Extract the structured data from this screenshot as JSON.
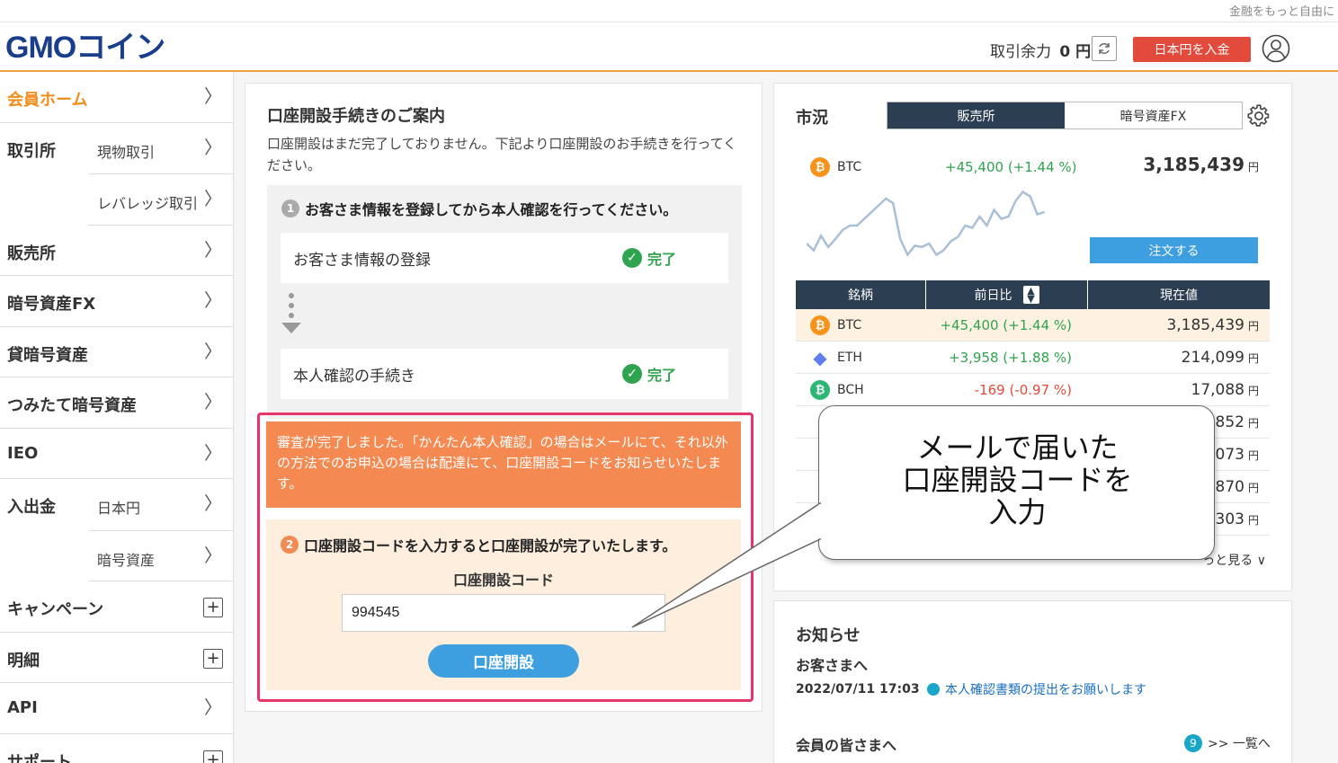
{
  "tagline": "金融をもっと自由に",
  "header": {
    "logo": "GMOコイン",
    "balance_label": "取引余力",
    "balance_value": "0 円",
    "deposit_button": "日本円を入金"
  },
  "sidebar": {
    "home": "会員ホーム",
    "exchange": "取引所",
    "spot": "現物取引",
    "leverage": "レバレッジ取引",
    "sales": "販売所",
    "crypto_fx": "暗号資産FX",
    "lending": "貸暗号資産",
    "tsumitate": "つみたて暗号資産",
    "ieo": "IEO",
    "deposit": "入出金",
    "jpy": "日本円",
    "crypto": "暗号資産",
    "campaign": "キャンペーン",
    "statement": "明細",
    "api": "API",
    "support": "サポート"
  },
  "guide": {
    "title": "口座開設手続きのご案内",
    "description": "口座開設はまだ完了しておりません。下記より口座開設のお手続きを行ってください。",
    "step1_num": "1",
    "step1_heading": "お客さま情報を登録してから本人確認を行ってください。",
    "step1a": "お客さま情報の登録",
    "step1b": "本人確認の手続き",
    "done": "完了",
    "notice": "審査が完了しました。「かんたん本人確認」の場合はメールにて、それ以外の方法でのお申込の場合は配達にて、口座開設コードをお知らせいたします。",
    "step2_num": "2",
    "step2_heading": "口座開設コードを入力すると口座開設が完了いたします。",
    "code_label": "口座開設コード",
    "code_value": "994545",
    "open_button": "口座開設"
  },
  "market": {
    "title": "市況",
    "tab_sales": "販売所",
    "tab_fx": "暗号資産FX",
    "hero_symbol": "BTC",
    "hero_change": "+45,400 (+1.44 %)",
    "hero_price": "3,185,439",
    "yen": "円",
    "order_button": "注文する",
    "col_symbol": "銘柄",
    "col_change": "前日比",
    "col_price": "現在値",
    "rows": [
      {
        "symbol": "BTC",
        "change": "+45,400 (+1.44 %)",
        "price": "3,185,439",
        "dir": "pos"
      },
      {
        "symbol": "ETH",
        "change": "+3,958 (+1.88 %)",
        "price": "214,099",
        "dir": "pos"
      },
      {
        "symbol": "BCH",
        "change": "-169 (-0.97 %)",
        "price": "17,088",
        "dir": "neg"
      },
      {
        "symbol": "",
        "change": "",
        "price": "852",
        "dir": "pos"
      },
      {
        "symbol": "",
        "change": "",
        "price": "073",
        "dir": "pos"
      },
      {
        "symbol": "",
        "change": "",
        "price": "870",
        "dir": "pos"
      },
      {
        "symbol": "",
        "change": "",
        "price": "303",
        "dir": "pos"
      }
    ],
    "more": "っと見る",
    "sparkline": [
      52,
      58,
      45,
      55,
      48,
      40,
      36,
      36,
      30,
      24,
      18,
      12,
      16,
      48,
      62,
      54,
      55,
      52,
      62,
      58,
      50,
      46,
      36,
      38,
      28,
      36,
      22,
      30,
      28,
      14,
      6,
      10,
      26,
      24
    ]
  },
  "news": {
    "title": "お知らせ",
    "section1": "お客さまへ",
    "date": "2022/07/11 17:03",
    "link": "本人確認書類の提出をお願いします",
    "section2": "会員の皆さまへ",
    "badge": "9",
    "list": ">> 一覧へ"
  },
  "callout": {
    "line1": "メールで届いた",
    "line2": "口座開設コードを",
    "line3": "入力"
  },
  "colors": {
    "brand": "#1a3d8c",
    "accent": "#f08c1a",
    "deposit": "#e24b3b",
    "positive": "#2fa34e",
    "negative": "#e24b3b",
    "highlight": "#e8336b",
    "notice": "#f48a52",
    "button": "#3d9ee0"
  }
}
